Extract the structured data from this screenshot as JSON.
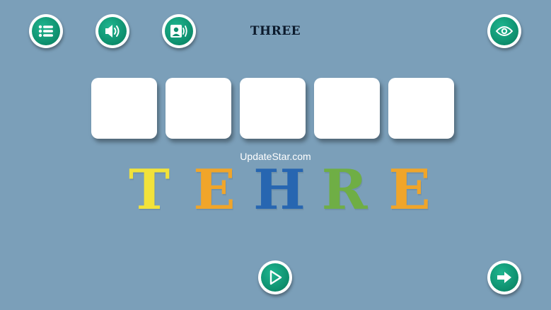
{
  "word": "THREE",
  "answer_slots": [
    "",
    "",
    "",
    "",
    ""
  ],
  "watermark": "UpdateStar.com",
  "scrambled_letters": [
    {
      "char": "T",
      "color": "#f2e23a"
    },
    {
      "char": "E",
      "color": "#f0a52a"
    },
    {
      "char": "H",
      "color": "#2766b1"
    },
    {
      "char": "R",
      "color": "#6fae45"
    },
    {
      "char": "E",
      "color": "#f0a52a"
    }
  ],
  "buttons": {
    "menu": "list-icon",
    "sound": "speaker-icon",
    "voice": "voice-icon",
    "reveal": "eye-icon",
    "play": "play-icon",
    "next": "arrow-right-icon"
  },
  "accent_color": "#0d8d6c"
}
